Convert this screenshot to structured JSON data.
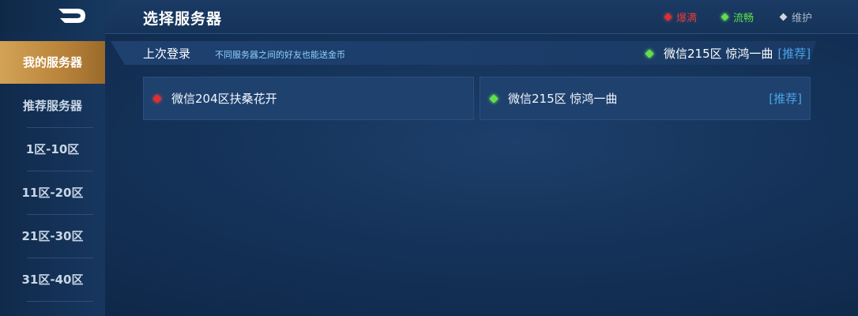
{
  "header": {
    "title": "选择服务器",
    "legend": {
      "full": "爆满",
      "smooth": "流畅",
      "maintenance": "维护"
    }
  },
  "sidebar": {
    "items": [
      {
        "label": "我的服务器"
      },
      {
        "label": "推荐服务器"
      },
      {
        "label": "1区-10区"
      },
      {
        "label": "11区-20区"
      },
      {
        "label": "21区-30区"
      },
      {
        "label": "31区-40区"
      }
    ]
  },
  "main": {
    "last_login_label": "上次登录",
    "hint": "不同服务器之间的好友也能送金币",
    "recent_server": {
      "name": "微信215区 惊鸿一曲",
      "tag": "[推荐]",
      "status": "smooth"
    },
    "servers": [
      {
        "name": "微信204区扶桑花开",
        "tag": "",
        "status": "full"
      },
      {
        "name": "微信215区 惊鸿一曲",
        "tag": "[推荐]",
        "status": "smooth"
      }
    ]
  },
  "colors": {
    "full": "#e12f2f",
    "smooth": "#61e04a",
    "maintenance": "#cfd6de",
    "active_tab": "#c8954a"
  },
  "icons": {
    "back": "back-arrow-icon",
    "status": "diamond-icon"
  }
}
